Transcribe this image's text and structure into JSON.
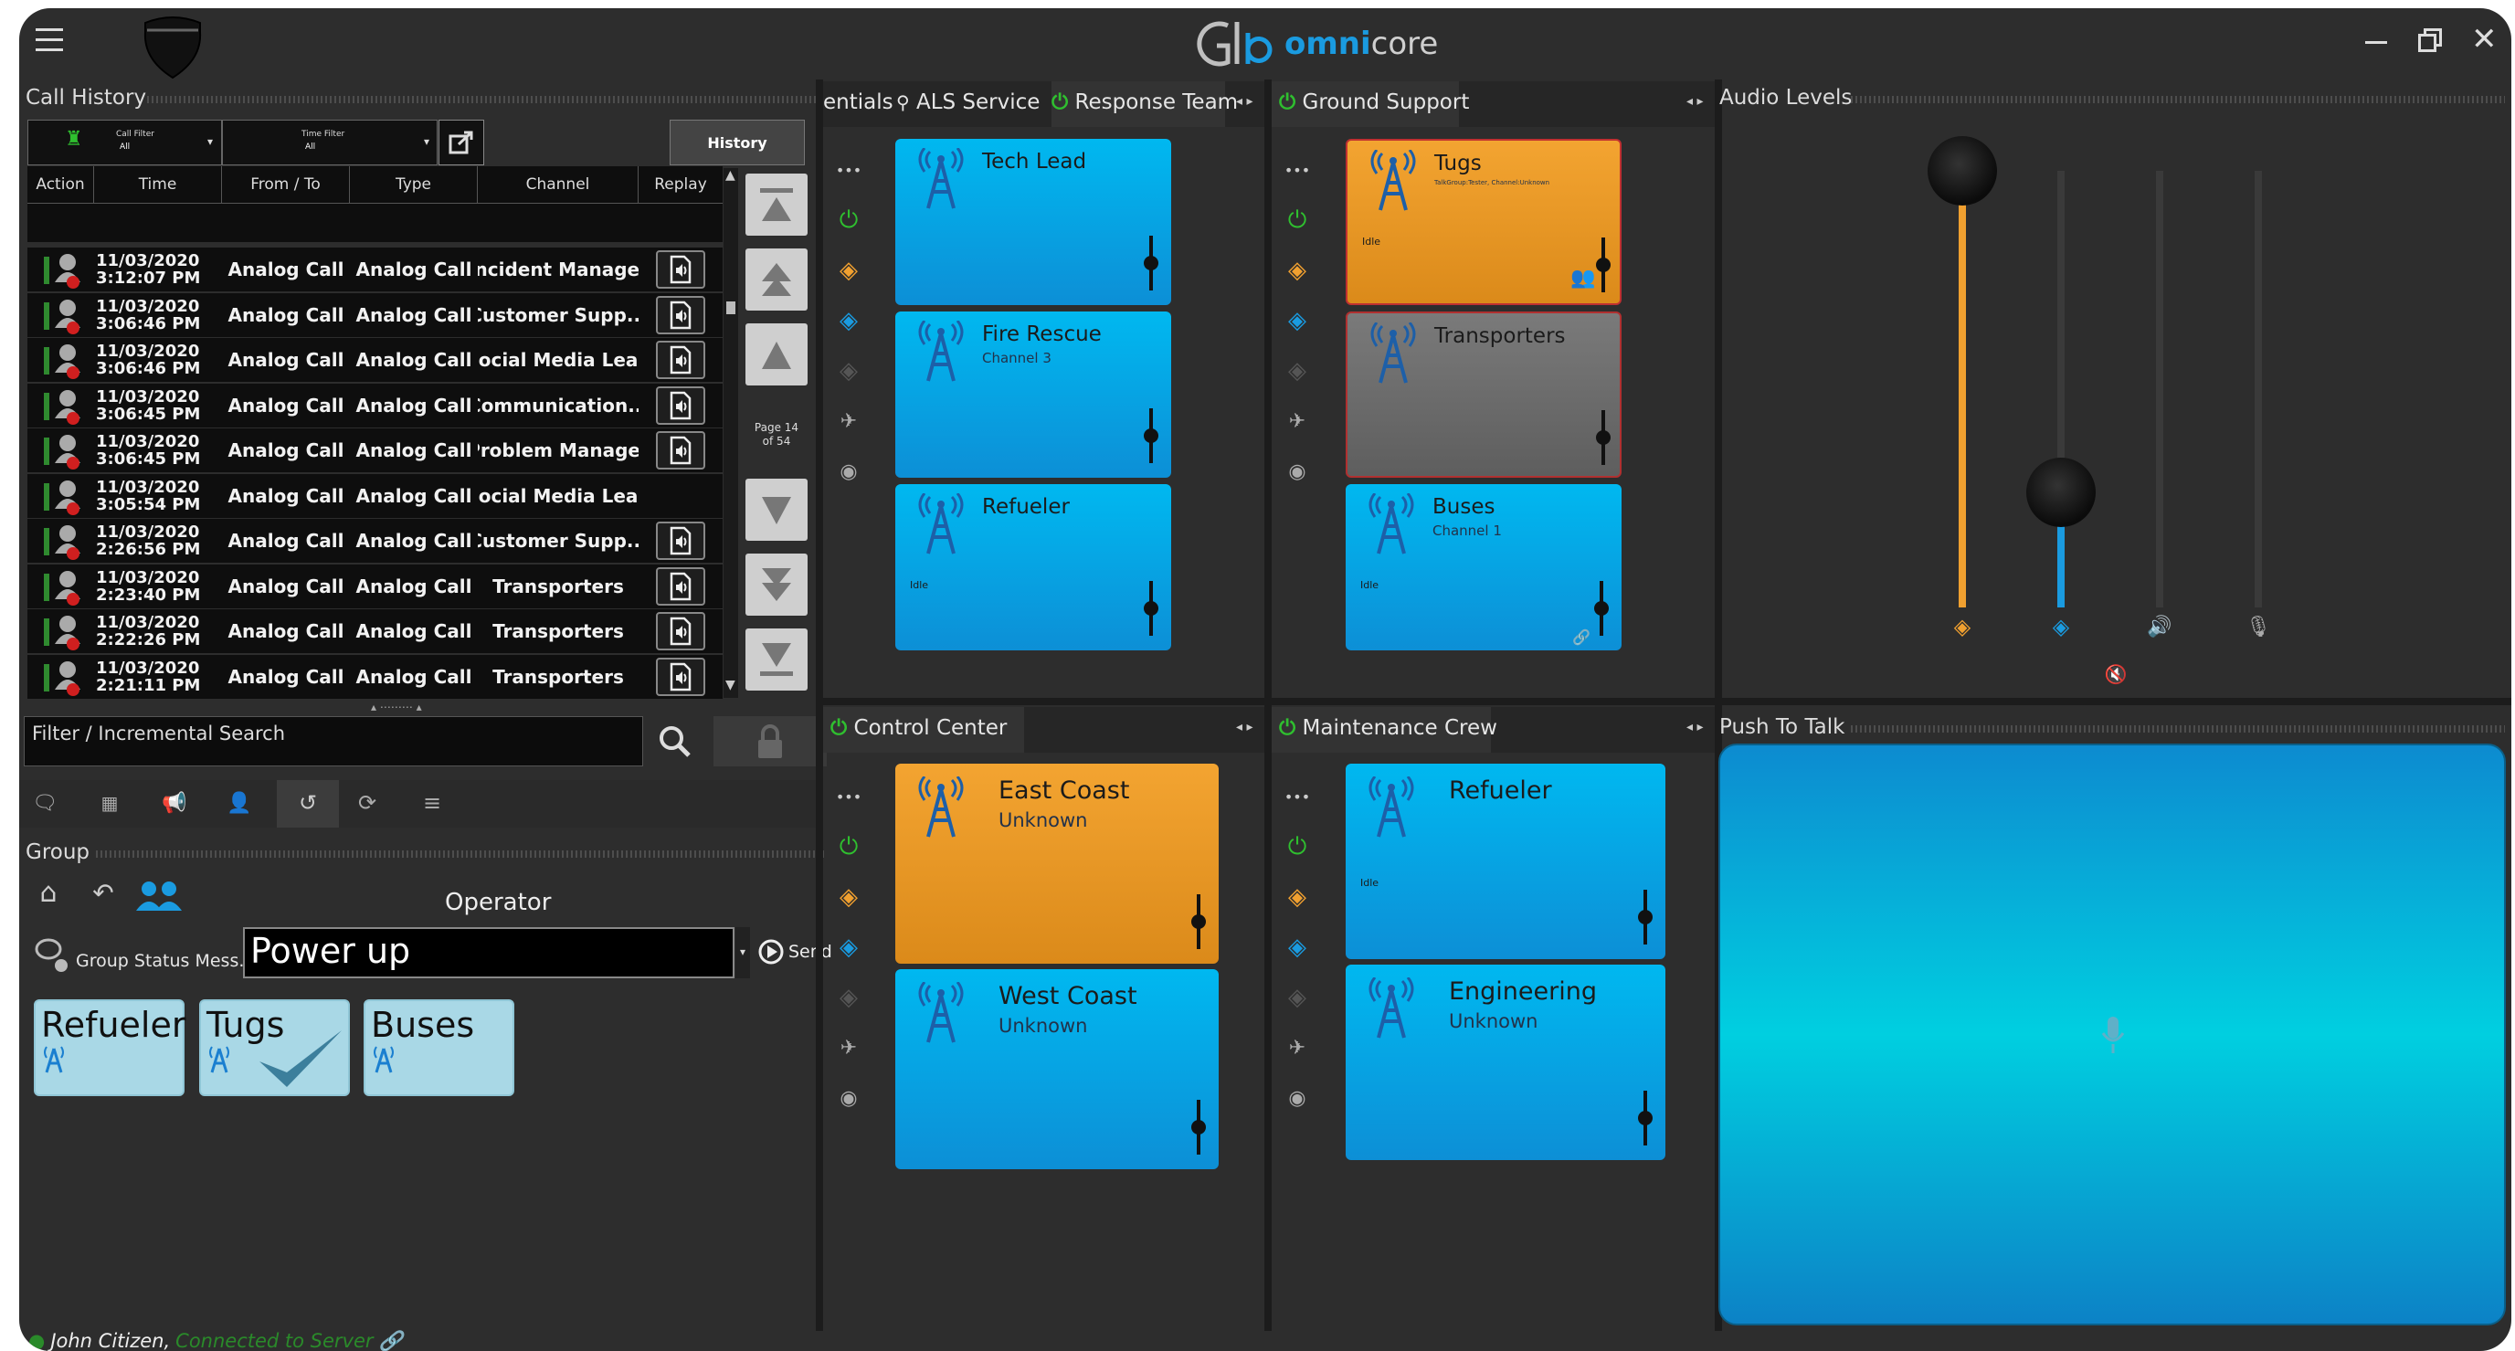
{
  "app": {
    "brand": "omnicore",
    "brand_accent": "omni",
    "brand_rest": "core",
    "user": "John Citizen,",
    "status": "Connected to Server"
  },
  "call_history": {
    "title": "Call History",
    "filter_call_label": "Call Filter",
    "filter_call_value": "All",
    "filter_time_label": "Time Filter",
    "filter_time_value": "All",
    "history_button": "History",
    "columns": [
      "Action",
      "Time",
      "From / To",
      "Type",
      "Channel",
      "Replay"
    ],
    "rows": [
      {
        "date": "11/03/2020",
        "time": "3:12:07 PM",
        "from_to": "Analog Call",
        "type": "Analog Call",
        "channel": "Incident Manager",
        "replay": true
      },
      {
        "date": "11/03/2020",
        "time": "3:06:46 PM",
        "from_to": "Analog Call",
        "type": "Analog Call",
        "channel": "Customer Supp...",
        "replay": true
      },
      {
        "date": "11/03/2020",
        "time": "3:06:46 PM",
        "from_to": "Analog Call",
        "type": "Analog Call",
        "channel": "Social Media Lead",
        "replay": true
      },
      {
        "date": "11/03/2020",
        "time": "3:06:45 PM",
        "from_to": "Analog Call",
        "type": "Analog Call",
        "channel": "Communication...",
        "replay": true
      },
      {
        "date": "11/03/2020",
        "time": "3:06:45 PM",
        "from_to": "Analog Call",
        "type": "Analog Call",
        "channel": "Problem Manager",
        "replay": true
      },
      {
        "date": "11/03/2020",
        "time": "3:05:54 PM",
        "from_to": "Analog Call",
        "type": "Analog Call",
        "channel": "Social Media Lead",
        "replay": false
      },
      {
        "date": "11/03/2020",
        "time": "2:26:56 PM",
        "from_to": "Analog Call",
        "type": "Analog Call",
        "channel": "Customer Supp...",
        "replay": true
      },
      {
        "date": "11/03/2020",
        "time": "2:23:40 PM",
        "from_to": "Analog Call",
        "type": "Analog Call",
        "channel": "Transporters",
        "replay": true
      },
      {
        "date": "11/03/2020",
        "time": "2:22:26 PM",
        "from_to": "Analog Call",
        "type": "Analog Call",
        "channel": "Transporters",
        "replay": true
      },
      {
        "date": "11/03/2020",
        "time": "2:21:11 PM",
        "from_to": "Analog Call",
        "type": "Analog Call",
        "channel": "Transporters",
        "replay": true
      }
    ],
    "page_line1": "Page 14",
    "page_line2": "of 54",
    "search_placeholder": "Filter / Incremental Search"
  },
  "group": {
    "title": "Group",
    "operator_label": "Operator",
    "status_label": "Group Status Mess...",
    "status_value": "Power up",
    "send_label": "Send",
    "buttons": [
      {
        "label": "Refueler",
        "checked": false
      },
      {
        "label": "Tugs",
        "checked": true
      },
      {
        "label": "Buses",
        "checked": false
      }
    ]
  },
  "panels": {
    "top_left": {
      "tabs": [
        "entials",
        "ALS Service",
        "Response Team"
      ],
      "tiles": [
        {
          "name": "Tech Lead",
          "sub": "",
          "idle": "",
          "color": "blue"
        },
        {
          "name": "Fire Rescue",
          "sub": "Channel 3",
          "idle": "",
          "color": "blue"
        },
        {
          "name": "Refueler",
          "sub": "",
          "idle": "Idle",
          "color": "blue"
        }
      ]
    },
    "top_right": {
      "title": "Ground Support",
      "tiles": [
        {
          "name": "Tugs",
          "sub": "TalkGroup:Tester, Channel:Unknown",
          "idle": "Idle",
          "color": "orange"
        },
        {
          "name": "Transporters",
          "sub": "",
          "idle": "",
          "color": "gray"
        },
        {
          "name": "Buses",
          "sub": "Channel 1",
          "idle": "Idle",
          "color": "blue"
        }
      ]
    },
    "bottom_left": {
      "title": "Control Center",
      "tiles": [
        {
          "name": "East Coast",
          "sub": "Unknown",
          "idle": "",
          "color": "orange"
        },
        {
          "name": "West Coast",
          "sub": "Unknown",
          "idle": "",
          "color": "blue"
        }
      ]
    },
    "bottom_right": {
      "title": "Maintenance Crew",
      "tiles": [
        {
          "name": "Refueler",
          "sub": "",
          "idle": "Idle",
          "color": "blue"
        },
        {
          "name": "Engineering",
          "sub": "Unknown",
          "idle": "",
          "color": "blue"
        }
      ]
    }
  },
  "audio": {
    "title": "Audio Levels",
    "levels": [
      {
        "name": "primary-level",
        "value": 0.95,
        "color": "#f0a030"
      },
      {
        "name": "secondary-level",
        "value": 0.38,
        "color": "#1a9be0"
      }
    ]
  },
  "ptt": {
    "title": "Push To Talk"
  },
  "colors": {
    "accent_blue": "#1a9be0",
    "accent_orange": "#f0a030",
    "power_green": "#2fbf2f",
    "status_green": "#2a8a2a"
  }
}
